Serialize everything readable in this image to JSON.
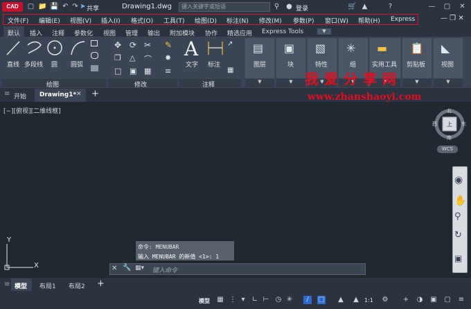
{
  "app": {
    "logo": "CAD",
    "share": "共享",
    "title": "Drawing1.dwg",
    "search_placeholder": "键入关键字或短语",
    "login": "登录"
  },
  "menu": [
    "文件(F)",
    "编辑(E)",
    "视图(V)",
    "插入(I)",
    "格式(O)",
    "工具(T)",
    "绘图(D)",
    "标注(N)",
    "修改(M)",
    "参数(P)",
    "窗口(W)",
    "帮助(H)",
    "Express"
  ],
  "ribbon_tabs": [
    "默认",
    "插入",
    "注释",
    "参数化",
    "视图",
    "管理",
    "输出",
    "附加模块",
    "协作",
    "精选应用",
    "Express Tools"
  ],
  "ribbon": {
    "draw": {
      "panel": "绘图",
      "line": "直线",
      "polyline": "多段线",
      "circle": "圆",
      "arc": "圆弧"
    },
    "modify": {
      "panel": "修改"
    },
    "annotation": {
      "panel": "注释",
      "text": "文字",
      "dimension": "标注"
    },
    "layers": "图层",
    "block": "块",
    "properties": "特性",
    "group": "组",
    "utilities": "实用工具",
    "clipboard": "剪贴板",
    "view": "视图"
  },
  "doc_tabs": {
    "start": "开始",
    "drawing": "Drawing1*"
  },
  "viewport_label": "[−][俯视][二维线框]",
  "viewcube": {
    "north": "北",
    "south": "南",
    "west": "西",
    "east": "东",
    "top": "上",
    "wcs": "WCS"
  },
  "ucs": {
    "y": "Y",
    "x": "X"
  },
  "command": {
    "history1": "命令: MENUBAR",
    "history2": "输入 MENUBAR 的新值 <1>: 1",
    "placeholder": "键入命令"
  },
  "watermark": {
    "cn": "我爱分享网",
    "url": "www.zhanshaoyi.com"
  },
  "layout_tabs": [
    "模型",
    "布局1",
    "布局2"
  ],
  "status": {
    "model": "模型",
    "scale": "1:1"
  },
  "colors": {
    "menu_highlight": "#d01a2a",
    "logo": "#c8102e",
    "watermark": "#e01020"
  }
}
